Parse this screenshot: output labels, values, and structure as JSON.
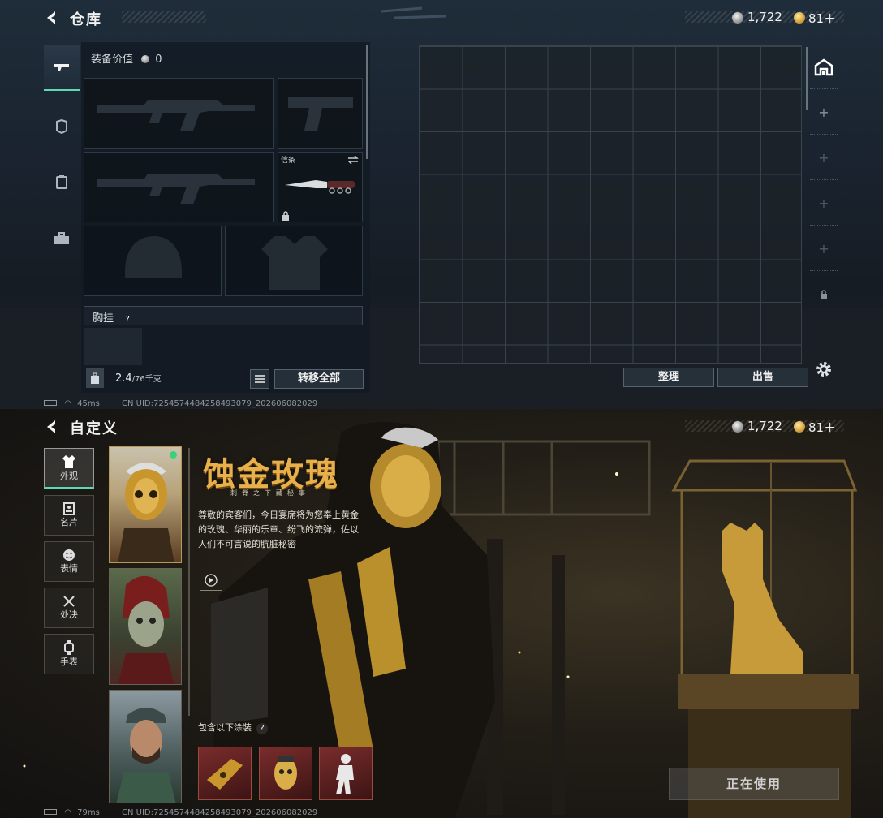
{
  "warehouse": {
    "title": "仓库",
    "currency": {
      "silver": "1,722",
      "gold": "81＋"
    },
    "tabs": [
      "weapon-icon",
      "armor-icon",
      "backpack-icon",
      "toolbox-icon"
    ],
    "equip_value_label": "装备价值",
    "equip_value": "0",
    "melee_label": "信条",
    "chest_rig_label": "胸挂",
    "help_mark": "?",
    "weight_current": "2.4",
    "weight_max": "/76千克",
    "transfer_all": "转移全部",
    "sort_label": "整理",
    "sell_label": "出售",
    "status": {
      "ping": "45ms",
      "uid": "CN UID:7254574484258493079_202606082029"
    }
  },
  "customize": {
    "title": "自定义",
    "currency": {
      "silver": "1,722",
      "gold": "81＋"
    },
    "tabs": [
      {
        "label": "外观",
        "icon": "outfit-icon"
      },
      {
        "label": "名片",
        "icon": "card-icon"
      },
      {
        "label": "表情",
        "icon": "emote-icon"
      },
      {
        "label": "处决",
        "icon": "execution-icon"
      },
      {
        "label": "手表",
        "icon": "watch-icon"
      }
    ],
    "skin_name": "蚀金玫瑰",
    "skin_subtitle": "刺脊之下藏秘事",
    "description": "尊敬的宾客们，今日宴席将为您奉上黄金的玫瑰、华丽的乐章、纷飞的流弹，佐以人们不可言说的肮脏秘密",
    "includes_label": "包含以下涂装",
    "help_mark": "?",
    "in_use": "正在使用",
    "status": {
      "ping": "79ms",
      "uid": "CN UID:7254574484258493079_202606082029"
    },
    "colors": {
      "accent": "#5fd9b3",
      "gold": "#e8b04a"
    }
  }
}
